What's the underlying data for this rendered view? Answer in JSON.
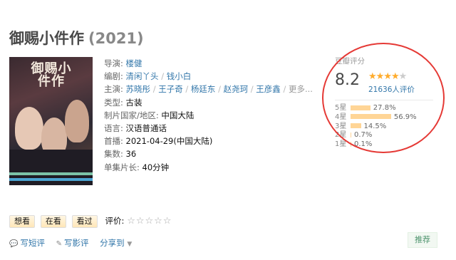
{
  "title": {
    "name": "御赐小件作",
    "year": "(2021)"
  },
  "poster": {
    "text": "御赐小件作"
  },
  "info": {
    "director_label": "导演:",
    "director": "楼健",
    "writer_label": "编剧:",
    "writers": [
      "清闲丫头",
      "钱小白"
    ],
    "cast_label": "主演:",
    "cast": [
      "苏晓彤",
      "王子奇",
      "杨廷东",
      "赵尧珂",
      "王彦鑫"
    ],
    "cast_more": "更多...",
    "genre_label": "类型:",
    "genre": "古装",
    "country_label": "制片国家/地区:",
    "country": "中国大陆",
    "language_label": "语言:",
    "language": "汉语普通话",
    "premiere_label": "首播:",
    "premiere": "2021-04-29(中国大陆)",
    "episodes_label": "集数:",
    "episodes": "36",
    "runtime_label": "单集片长:",
    "runtime": "40分钟"
  },
  "rating": {
    "label": "豆瓣评分",
    "score": "8.2",
    "stars_filled": 4,
    "count": "21636人评价",
    "distribution": [
      {
        "label": "5星",
        "pct": "27.8%",
        "value": 27.8
      },
      {
        "label": "4星",
        "pct": "56.9%",
        "value": 56.9
      },
      {
        "label": "3星",
        "pct": "14.5%",
        "value": 14.5
      },
      {
        "label": "2星",
        "pct": "0.7%",
        "value": 0.7
      },
      {
        "label": "1星",
        "pct": "0.1%",
        "value": 0.1
      }
    ],
    "bar_color": "#ffd596",
    "star_color": "#ffac2d"
  },
  "actions": {
    "want": "想看",
    "watching": "在看",
    "watched": "看过",
    "rate_label": "评价:"
  },
  "links": {
    "short_review": "写短评",
    "review": "写影评",
    "share": "分享到"
  },
  "recommend": "推荐",
  "colors": {
    "link": "#3377aa",
    "highlight_ellipse": "#e53935"
  }
}
